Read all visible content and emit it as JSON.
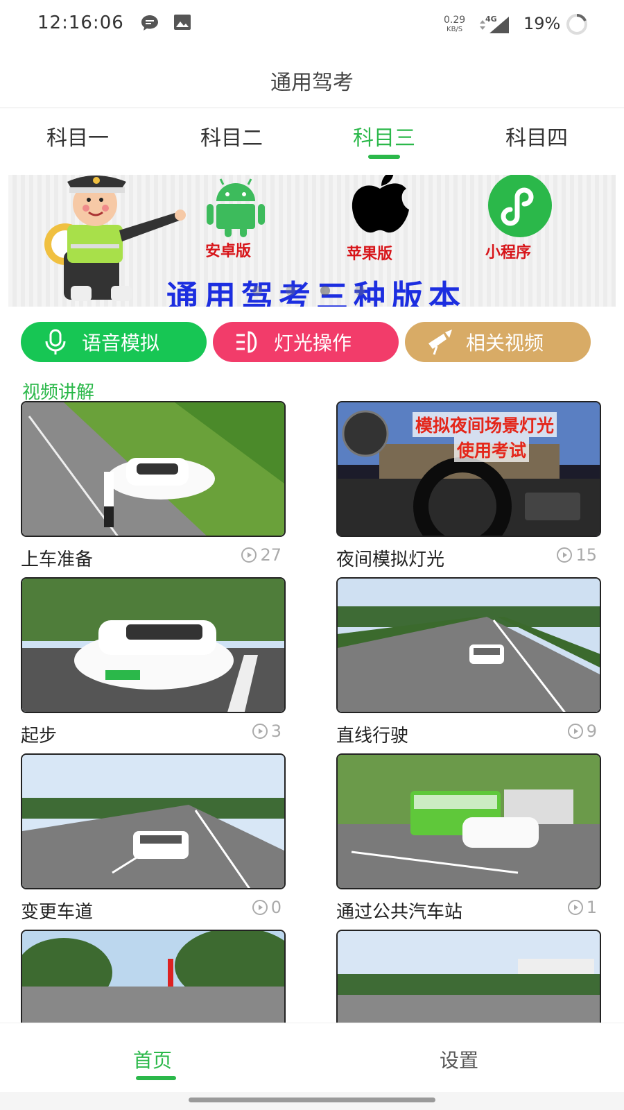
{
  "status": {
    "time": "12:16:06",
    "speed": "0.29",
    "speed_unit": "KB/S",
    "network": "4G",
    "battery": "19%"
  },
  "header": {
    "title": "通用驾考"
  },
  "tabs": [
    "科目一",
    "科目二",
    "科目三",
    "科目四"
  ],
  "active_tab": "科目三",
  "banner": {
    "labels": [
      "安卓版",
      "苹果版",
      "小程序"
    ],
    "headline": "通用驾考三种版本",
    "current_slide": 2,
    "slide_count": 4
  },
  "actions": [
    {
      "label": "语音模拟",
      "color": "#17c654",
      "icon": "microphone-icon"
    },
    {
      "label": "灯光操作",
      "color": "#f23c6a",
      "icon": "headlight-icon"
    },
    {
      "label": "相关视频",
      "color": "#d8ab66",
      "icon": "video-camera-icon"
    }
  ],
  "section": {
    "title": "视频讲解"
  },
  "videos": [
    {
      "title": "上车准备",
      "views": "27"
    },
    {
      "title": "夜间模拟灯光",
      "views": "15",
      "overlay": [
        "模拟夜间场景灯光",
        "使用考试"
      ]
    },
    {
      "title": "起步",
      "views": "3"
    },
    {
      "title": "直线行驶",
      "views": "9"
    },
    {
      "title": "变更车道",
      "views": "0"
    },
    {
      "title": "通过公共汽车站",
      "views": "1"
    },
    {
      "title": "",
      "views": ""
    },
    {
      "title": "",
      "views": ""
    }
  ],
  "bottom_nav": {
    "home": "首页",
    "settings": "设置"
  },
  "colors": {
    "accent": "#2bb84a"
  }
}
